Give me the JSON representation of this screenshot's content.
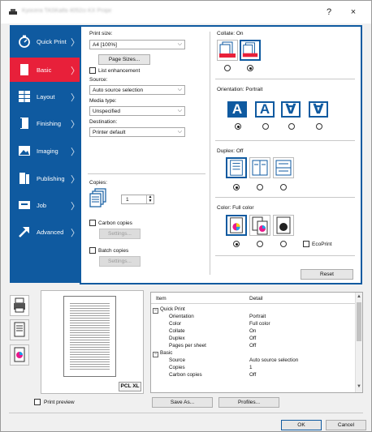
{
  "window": {
    "title": "Kyocera TASKalfa 4052ci KX Properties",
    "help_label": "?",
    "close_label": "×"
  },
  "sidebar": {
    "items": [
      {
        "label": "Quick Print",
        "icon": "stopwatch-icon"
      },
      {
        "label": "Basic",
        "icon": "page-icon"
      },
      {
        "label": "Layout",
        "icon": "layout-grid-icon"
      },
      {
        "label": "Finishing",
        "icon": "finishing-icon"
      },
      {
        "label": "Imaging",
        "icon": "image-icon"
      },
      {
        "label": "Publishing",
        "icon": "publishing-icon"
      },
      {
        "label": "Job",
        "icon": "job-icon"
      },
      {
        "label": "Advanced",
        "icon": "advanced-arrow-icon"
      }
    ],
    "active": "Basic",
    "colors": {
      "bg": "#0f5aa0",
      "active": "#e8203a"
    }
  },
  "basic": {
    "print_size_label": "Print size:",
    "print_size_value": "A4 [100%]",
    "page_sizes_button": "Page Sizes...",
    "list_enhancement_label": "List enhancement",
    "source_label": "Source:",
    "source_value": "Auto source selection",
    "media_type_label": "Media type:",
    "media_type_value": "Unspecified",
    "destination_label": "Destination:",
    "destination_value": "Printer default",
    "copies_label": "Copies:",
    "copies_value": "1",
    "carbon_copies_label": "Carbon copies",
    "carbon_settings_button": "Settings...",
    "batch_copies_label": "Batch copies",
    "batch_settings_button": "Settings...",
    "collate_label": "Collate:  On",
    "orientation_label": "Orientation:  Portrait",
    "orientation_glyphs": [
      "A",
      "A",
      "∀",
      "∀"
    ],
    "duplex_label": "Duplex:  Off",
    "color_label": "Color:  Full color",
    "ecoprint_label": "EcoPrint",
    "reset_button": "Reset"
  },
  "preview": {
    "pcl_badge": "PCL XL",
    "print_preview_label": "Print preview",
    "save_as_button": "Save As...",
    "profiles_button": "Profiles..."
  },
  "summary": {
    "col_item": "Item",
    "col_detail": "Detail",
    "rows": [
      {
        "item": "Quick Print",
        "detail": "",
        "group": true
      },
      {
        "item": "Orientation",
        "detail": "Portrait"
      },
      {
        "item": "Color",
        "detail": "Full color"
      },
      {
        "item": "Collate",
        "detail": "On"
      },
      {
        "item": "Duplex",
        "detail": "Off"
      },
      {
        "item": "Pages per sheet",
        "detail": "Off"
      },
      {
        "item": "Basic",
        "detail": "",
        "group": true
      },
      {
        "item": "Source",
        "detail": "Auto source selection"
      },
      {
        "item": "Copies",
        "detail": "1"
      },
      {
        "item": "Carbon copies",
        "detail": "Off"
      }
    ]
  },
  "footer": {
    "ok_button": "OK",
    "cancel_button": "Cancel"
  }
}
